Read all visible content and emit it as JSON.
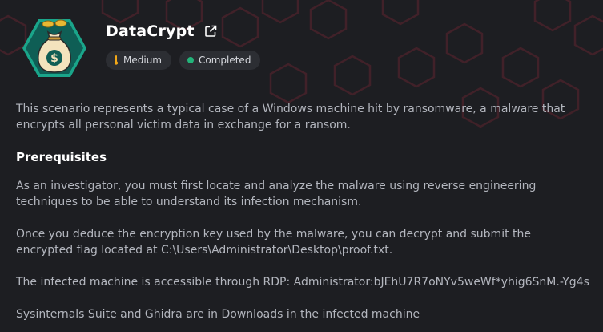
{
  "header": {
    "title": "DataCrypt",
    "external_link_icon": "external-link-icon",
    "logo_icon": "money-bag-icon"
  },
  "badges": {
    "difficulty": {
      "label": "Medium",
      "icon": "thermometer-icon",
      "color": "#f2a818"
    },
    "status": {
      "label": "Completed",
      "icon": "status-dot",
      "color": "#23b47a"
    }
  },
  "description": "This scenario represents a typical case of a Windows machine hit by ransomware, a malware that encrypts all personal victim data in exchange for a ransom.",
  "prerequisites": {
    "heading": "Prerequisites",
    "paragraphs": [
      "As an investigator, you must first locate and analyze the malware using reverse engineering techniques to be able to understand its infection mechanism.",
      "Once you deduce the encryption key used by the malware, you can decrypt and submit the encrypted flag located at C:\\Users\\Administrator\\Desktop\\proof.txt.",
      "The infected machine is accessible through RDP: Administrator:bJEhU7R7oNYv5weWf*yhig6SnM.-Yg4s",
      "Sysinternals Suite and Ghidra are in Downloads in the infected machine"
    ]
  },
  "colors": {
    "background": "#1d1e22",
    "hex_pattern": "#5a2530",
    "badge_bg": "#2c2e33",
    "logo_ring": "#1aa58a"
  }
}
